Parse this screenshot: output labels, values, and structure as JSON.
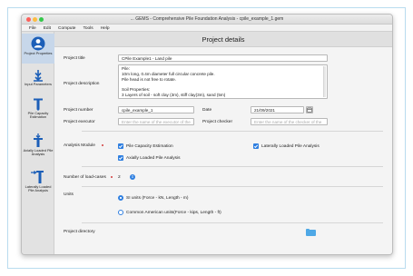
{
  "window": {
    "title": "... GEMS - Comprehensive Pile Foundation Analysis - cpile_example_1.gem"
  },
  "menu": [
    "File",
    "Edit",
    "Compute",
    "Tools",
    "Help"
  ],
  "sidebar": {
    "items": [
      {
        "label": "Project Properties",
        "icon": "project-properties-icon",
        "active": true
      },
      {
        "label": "Input Parameters",
        "icon": "input-parameters-icon",
        "active": false
      },
      {
        "label": "Pile Capacity Estimation",
        "icon": "pile-capacity-icon",
        "active": false
      },
      {
        "label": "Axially Loaded Pile Analysis",
        "icon": "axially-loaded-icon",
        "active": false
      },
      {
        "label": "Laterally Loaded Pile Analysis",
        "icon": "laterally-loaded-icon",
        "active": false
      }
    ]
  },
  "page": {
    "title": "Project details",
    "project_title": {
      "label": "Project title",
      "value": "CPile Example1 - Land pile"
    },
    "project_description": {
      "label": "Project description",
      "lines": [
        "Pile:",
        "10m long, 0.4m diameter full circular concrete pile.",
        "Pile head is not free to rotate.",
        "",
        "Soil Properties:",
        "3 Layers of soil - soft clay (3m), stiff clay(3m), sand (5m)"
      ]
    },
    "project_number": {
      "label": "Project number",
      "value": "cpile_example_1"
    },
    "date": {
      "label": "Date",
      "value": "21/09/2021"
    },
    "project_executor": {
      "label": "Project executor",
      "placeholder": "Enter the name of the executor of the"
    },
    "project_checker": {
      "label": "Project checker",
      "placeholder": "Enter the name of the checker of the"
    },
    "analysis_module": {
      "label": "Analysis Module",
      "options": [
        {
          "label": "Pile Capacity Estimation",
          "checked": true
        },
        {
          "label": "Laterally Loaded Pile Analysis",
          "checked": true
        },
        {
          "label": "Axially Loaded Pile Analysis",
          "checked": true
        }
      ]
    },
    "load_cases": {
      "label": "Number of load-cases",
      "value": "2"
    },
    "units": {
      "label": "Units",
      "options": [
        {
          "label": "SI units (Force - kN, Length - m)",
          "selected": true
        },
        {
          "label": "Common American units(Force - kips, Length - ft)",
          "selected": false
        }
      ]
    },
    "project_directory": {
      "label": "Project directory"
    }
  },
  "colors": {
    "accent": "#2f7fe0",
    "active_sidebar": "#c7d7ea",
    "folder": "#4ea8e6",
    "required_dot": "#d13b3b"
  }
}
